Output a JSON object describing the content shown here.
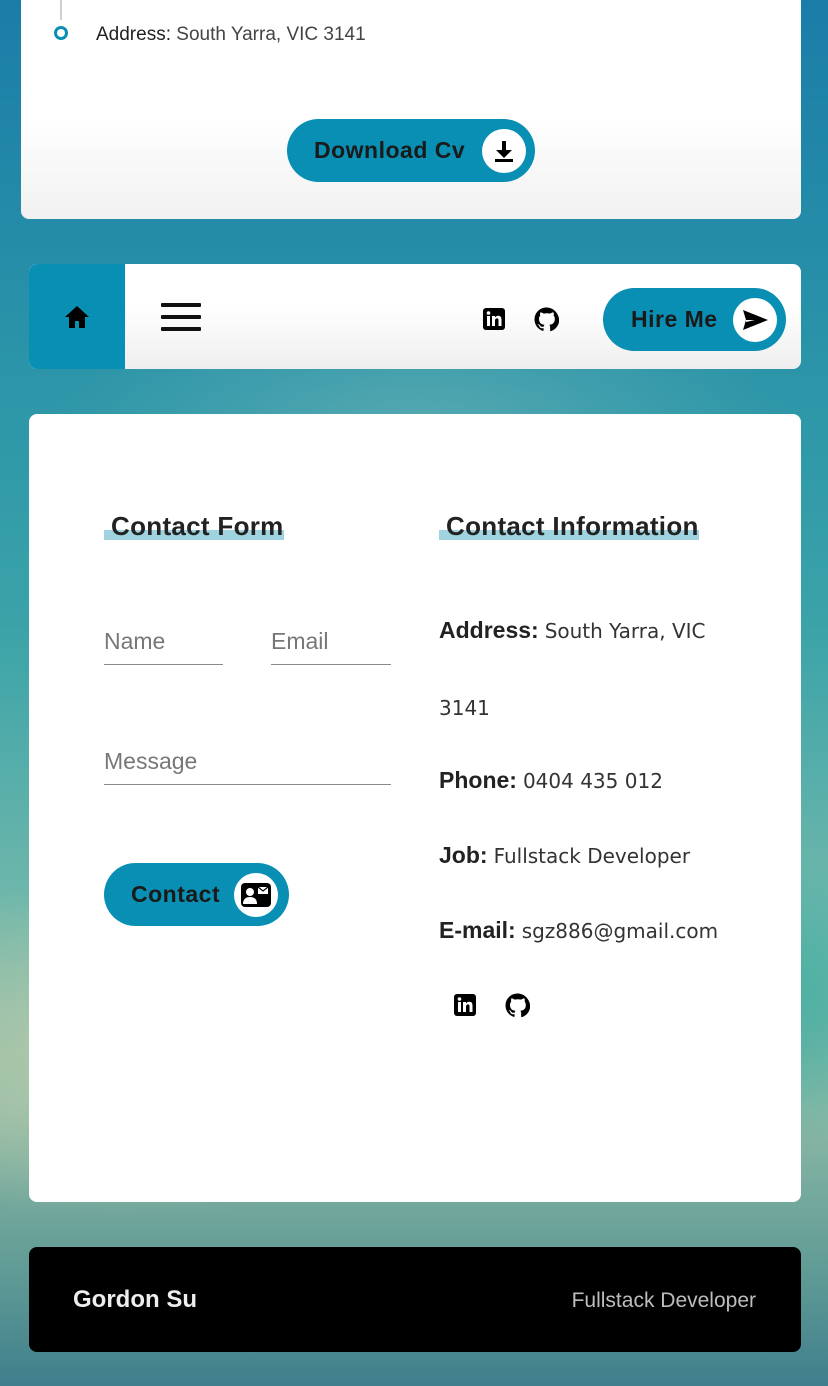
{
  "resume": {
    "address_label": "Address:",
    "address_value": "South Yarra, VIC 3141",
    "download_label": "Download Cv"
  },
  "navbar": {
    "hire_label": "Hire Me"
  },
  "contact_form": {
    "title": "Contact Form",
    "name_placeholder": "Name",
    "email_placeholder": "Email",
    "message_placeholder": "Message",
    "submit_label": "Contact"
  },
  "contact_info": {
    "title": "Contact Information",
    "address_label": "Address:",
    "address_value_line1": "South Yarra, VIC",
    "address_value_line2": "3141",
    "phone_label": "Phone:",
    "phone_value": "0404 435 012",
    "job_label": "Job:",
    "job_value": "Fullstack Developer",
    "email_label": "E-mail:",
    "email_value": "sgz886@gmail.com"
  },
  "footer": {
    "name": "Gordon Su",
    "role": "Fullstack Developer"
  },
  "colors": {
    "accent": "#0a8fb4",
    "highlight": "#9fd3df",
    "footer_bg": "#000000"
  },
  "icons": [
    "download-icon",
    "home-icon",
    "menu-icon",
    "linkedin-icon",
    "github-icon",
    "send-icon",
    "contact-card-icon"
  ]
}
